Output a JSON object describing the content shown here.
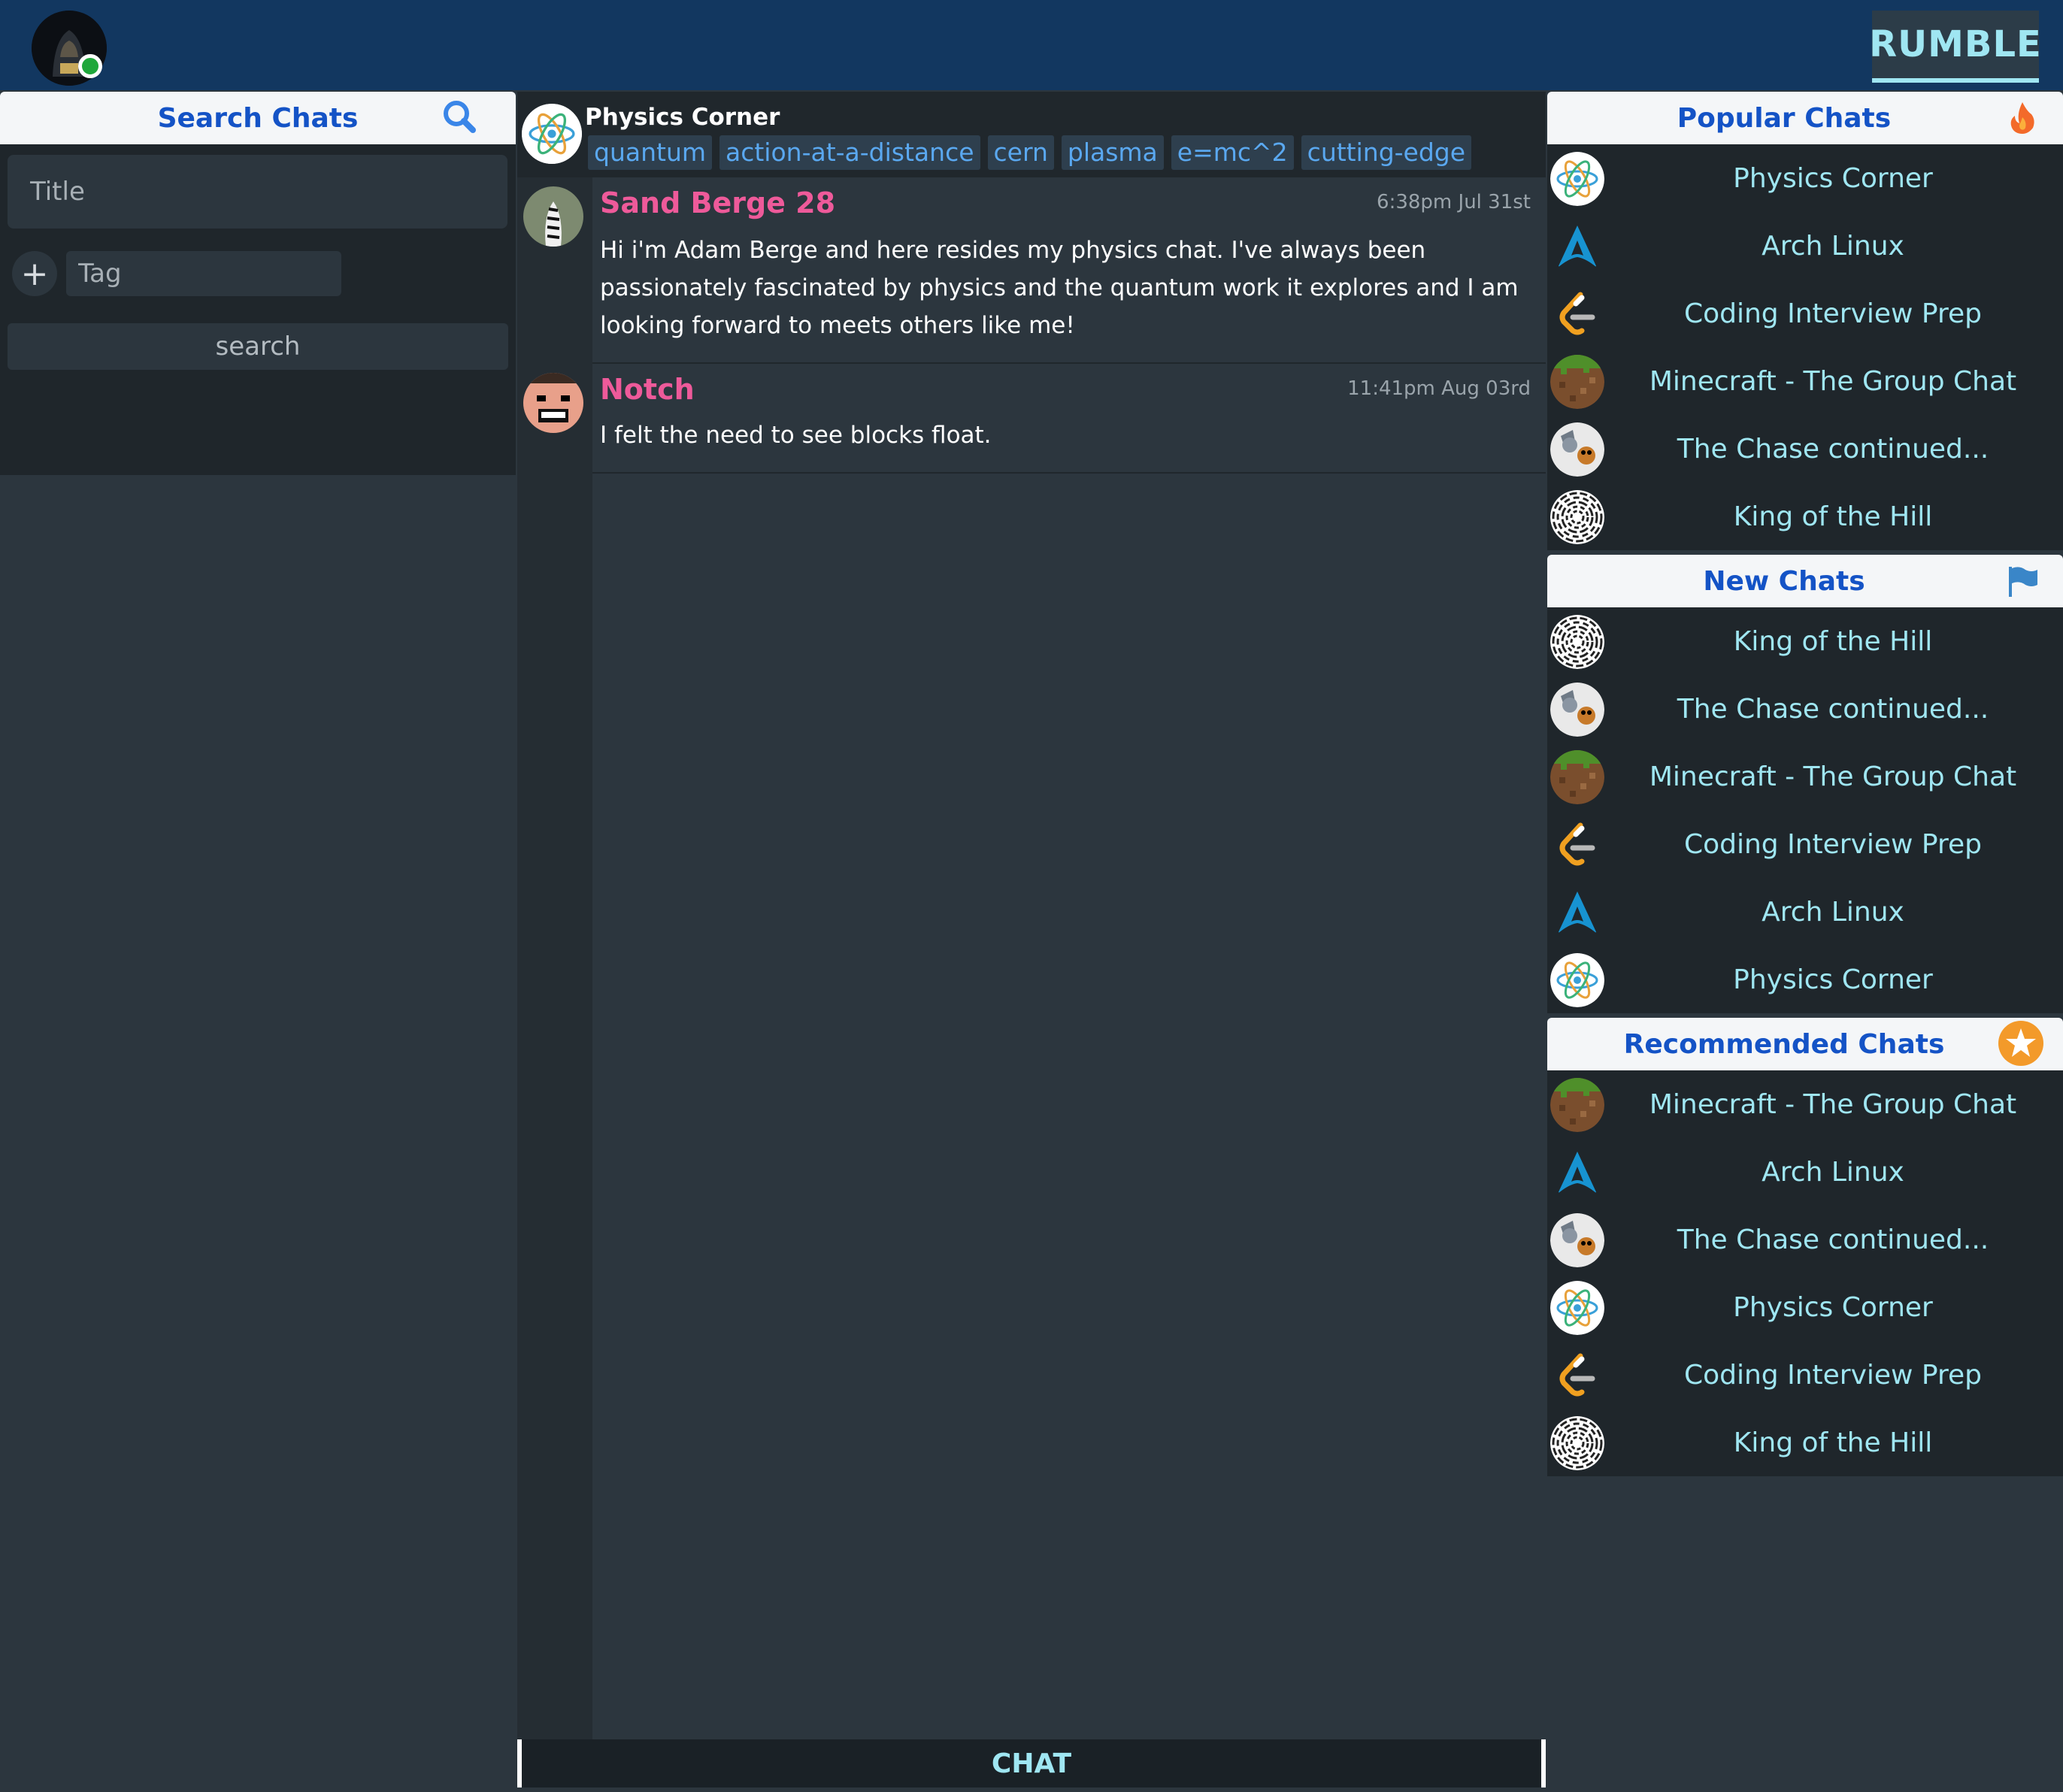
{
  "brand": "RUMBLE",
  "colors": {
    "header": "#123760",
    "accent": "#9fe6f2",
    "link": "#1453c6",
    "username": "#ee5a9a",
    "tag": "#5aa8f0",
    "online": "#1fa73b"
  },
  "search": {
    "header": "Search Chats",
    "title_placeholder": "Title",
    "tag_placeholder": "Tag",
    "add_tag": "+",
    "button": "search"
  },
  "chat": {
    "title": "Physics Corner",
    "tags": [
      "quantum",
      "action-at-a-distance",
      "cern",
      "plasma",
      "e=mc^2",
      "cutting-edge"
    ],
    "messages": [
      {
        "user": "Sand Berge 28",
        "time": "6:38pm Jul 31st",
        "text": "Hi i'm Adam Berge and here resides my physics chat. I've always been passionately fascinated by physics and the quantum work it explores and I am looking forward to meets others like me!",
        "avatar": "zebra-avatar"
      },
      {
        "user": "Notch",
        "time": "11:41pm Aug 03rd",
        "text": "I felt the need to see blocks float.",
        "avatar": "notch-avatar"
      }
    ],
    "footer": "CHAT"
  },
  "popular": {
    "header": "Popular Chats",
    "icon": "fire-icon",
    "items": [
      {
        "label": "Physics Corner",
        "icon": "atom-icon"
      },
      {
        "label": "Arch Linux",
        "icon": "arch-icon"
      },
      {
        "label": "Coding Interview Prep",
        "icon": "leetcode-icon"
      },
      {
        "label": "Minecraft - The Group Chat",
        "icon": "dirt-block-icon"
      },
      {
        "label": "The Chase continued...",
        "icon": "tom-jerry-icon"
      },
      {
        "label": "King of the Hill",
        "icon": "maze-icon"
      }
    ]
  },
  "new": {
    "header": "New Chats",
    "icon": "flag-icon",
    "items": [
      {
        "label": "King of the Hill",
        "icon": "maze-icon"
      },
      {
        "label": "The Chase continued...",
        "icon": "tom-jerry-icon"
      },
      {
        "label": "Minecraft - The Group Chat",
        "icon": "dirt-block-icon"
      },
      {
        "label": "Coding Interview Prep",
        "icon": "leetcode-icon"
      },
      {
        "label": "Arch Linux",
        "icon": "arch-icon"
      },
      {
        "label": "Physics Corner",
        "icon": "atom-icon"
      }
    ]
  },
  "recommended": {
    "header": "Recommended Chats",
    "icon": "star-icon",
    "items": [
      {
        "label": "Minecraft - The Group Chat",
        "icon": "dirt-block-icon"
      },
      {
        "label": "Arch Linux",
        "icon": "arch-icon"
      },
      {
        "label": "The Chase continued...",
        "icon": "tom-jerry-icon"
      },
      {
        "label": "Physics Corner",
        "icon": "atom-icon"
      },
      {
        "label": "Coding Interview Prep",
        "icon": "leetcode-icon"
      },
      {
        "label": "King of the Hill",
        "icon": "maze-icon"
      }
    ]
  }
}
